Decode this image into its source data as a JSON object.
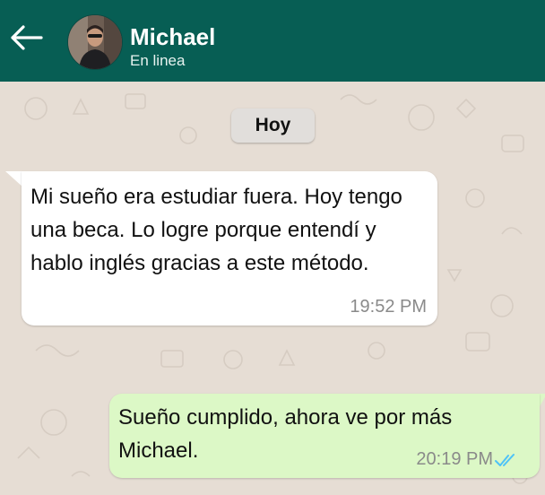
{
  "header": {
    "contact_name": "Michael",
    "status": "En linea",
    "back_icon": "arrow-left-icon",
    "background_color": "#075e54"
  },
  "chat": {
    "date_label": "Hoy",
    "messages": [
      {
        "direction": "incoming",
        "text": "Mi sueño era estudiar fuera. Hoy tengo una beca. Lo logre porque entendí y hablo inglés gracias a este método.",
        "time": "19:52 PM"
      },
      {
        "direction": "outgoing",
        "text": "Sueño cumplido, ahora ve por más Michael.",
        "time": "20:19 PM",
        "status_icon": "double-check-icon",
        "status_color": "#4fc3f7"
      }
    ],
    "outgoing_bubble_color": "#dcf8c6",
    "incoming_bubble_color": "#ffffff"
  }
}
